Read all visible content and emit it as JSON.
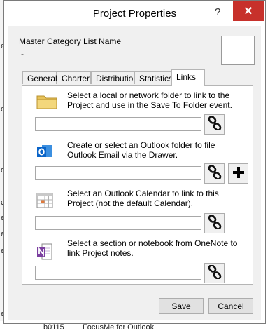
{
  "background": {
    "left_fragments": [
      "e",
      "c",
      "d",
      "c",
      "e",
      "e",
      "e",
      "e"
    ],
    "bottom_fragments": [
      "b0115",
      "FocusMe for Outlook"
    ]
  },
  "dialog": {
    "title": "Project Properties",
    "help_label": "?",
    "close_label": "✕",
    "master_category_label": "Master Category List Name",
    "master_category_value": "-",
    "tabs": [
      "General",
      "Charter",
      "Distribution",
      "Statistics",
      "Links"
    ],
    "active_tab": "Links",
    "links": {
      "folder_text": "Select a local or network folder to link to the Project and use in the Save To Folder event.",
      "folder_value": "",
      "outlook_text": "Create or select an Outlook folder to file Outlook Email via the Drawer.",
      "outlook_value": "",
      "calendar_text": "Select an Outlook Calendar to link to this Project (not the default Calendar).",
      "calendar_value": "",
      "onenote_text": "Select a section or notebook from OneNote to link Project notes.",
      "onenote_value": ""
    },
    "save_label": "Save",
    "cancel_label": "Cancel"
  },
  "colors": {
    "close_red": "#c7312b",
    "folder_yellow": "#e8c35a",
    "outlook_blue": "#0a64c8",
    "onenote_purple": "#7b3fa0"
  }
}
